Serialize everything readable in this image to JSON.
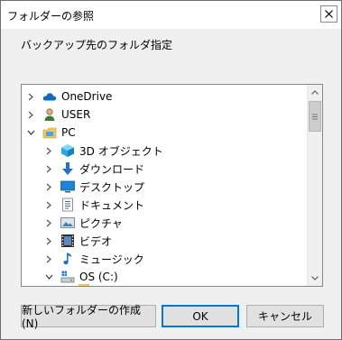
{
  "window": {
    "title": "フォルダーの参照",
    "close_glyph": "✕"
  },
  "instruction": "バックアップ先のフォルダ指定",
  "tree": {
    "items": [
      {
        "label": "OneDrive",
        "icon": "cloud-icon",
        "expanded": false,
        "level": 0
      },
      {
        "label": "USER",
        "icon": "user-icon",
        "expanded": false,
        "level": 0
      },
      {
        "label": "PC",
        "icon": "pc-icon",
        "expanded": true,
        "level": 0
      },
      {
        "label": "3D オブジェクト",
        "icon": "3d-objects-icon",
        "expanded": false,
        "level": 1
      },
      {
        "label": "ダウンロード",
        "icon": "download-icon",
        "expanded": false,
        "level": 1
      },
      {
        "label": "デスクトップ",
        "icon": "desktop-icon",
        "expanded": false,
        "level": 1
      },
      {
        "label": "ドキュメント",
        "icon": "documents-icon",
        "expanded": false,
        "level": 1
      },
      {
        "label": "ピクチャ",
        "icon": "pictures-icon",
        "expanded": false,
        "level": 1
      },
      {
        "label": "ビデオ",
        "icon": "videos-icon",
        "expanded": false,
        "level": 1
      },
      {
        "label": "ミュージック",
        "icon": "music-icon",
        "expanded": false,
        "level": 1
      },
      {
        "label": "OS (C:)",
        "icon": "drive-icon",
        "expanded": true,
        "level": 1
      }
    ]
  },
  "buttons": {
    "new_folder": "新しいフォルダーの作成(N)",
    "ok": "OK",
    "cancel": "キャンセル"
  },
  "colors": {
    "accent": "#0078d7",
    "onedrive": "#0f6cbd",
    "folder": "#f5c84c"
  }
}
